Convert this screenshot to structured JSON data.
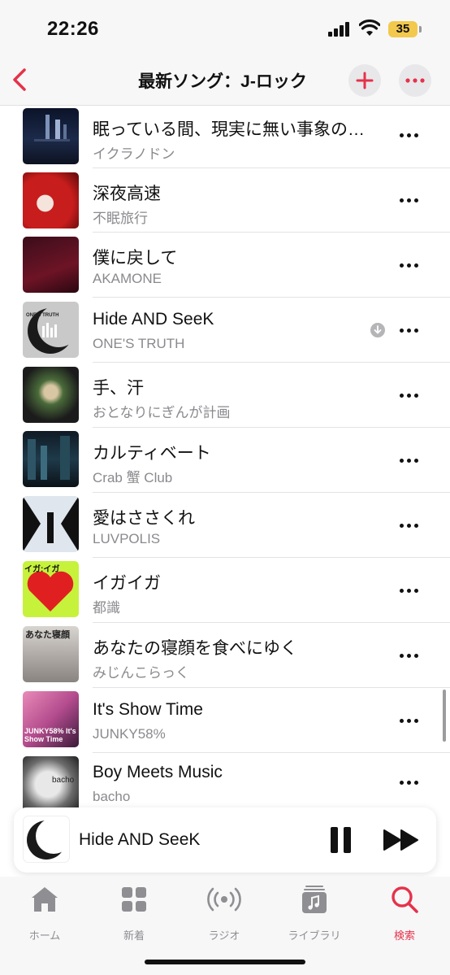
{
  "status_bar": {
    "time": "22:26",
    "battery": "35"
  },
  "nav": {
    "title": "最新ソング：J-ロック"
  },
  "songs": [
    {
      "title": "眠っている間、現実に無い事象の…",
      "artist": "イクラノドン",
      "downloaded": false
    },
    {
      "title": "深夜高速",
      "artist": "不眠旅行",
      "downloaded": false
    },
    {
      "title": "僕に戻して",
      "artist": "AKAMONE",
      "downloaded": false
    },
    {
      "title": "Hide AND SeeK",
      "artist": "ONE'S TRUTH",
      "downloaded": true
    },
    {
      "title": "手、汗",
      "artist": "おとなりにぎんが計画",
      "downloaded": false
    },
    {
      "title": "カルティベート",
      "artist": "Crab 蟹 Club",
      "downloaded": false
    },
    {
      "title": "愛はささくれ",
      "artist": "LUVPOLIS",
      "downloaded": false
    },
    {
      "title": "イガイガ",
      "artist": "都識",
      "downloaded": false
    },
    {
      "title": "あなたの寝顔を食べにゆく",
      "artist": "みじんこらっく",
      "downloaded": false
    },
    {
      "title": "It's Show Time",
      "artist": "JUNKY58%",
      "downloaded": false
    },
    {
      "title": "Boy Meets Music",
      "artist": "bacho",
      "downloaded": false
    }
  ],
  "artwork_text": {
    "song_4": "ONE'S TRUTH",
    "song_8": "イガ:イガ",
    "song_9": "あなた寝顔",
    "song_10": "JUNKY58% It's Show Time",
    "song_11": "bacho"
  },
  "mini_player": {
    "title": "Hide AND SeeK"
  },
  "tabs": [
    {
      "label": "ホーム",
      "icon": "home-icon",
      "active": false
    },
    {
      "label": "新着",
      "icon": "grid-icon",
      "active": false
    },
    {
      "label": "ラジオ",
      "icon": "radio-icon",
      "active": false
    },
    {
      "label": "ライブラリ",
      "icon": "library-icon",
      "active": false
    },
    {
      "label": "検索",
      "icon": "search-icon",
      "active": true
    }
  ],
  "colors": {
    "accent": "#e5324b",
    "secondary_text": "#8a8a8e",
    "battery": "#f2c94c"
  }
}
